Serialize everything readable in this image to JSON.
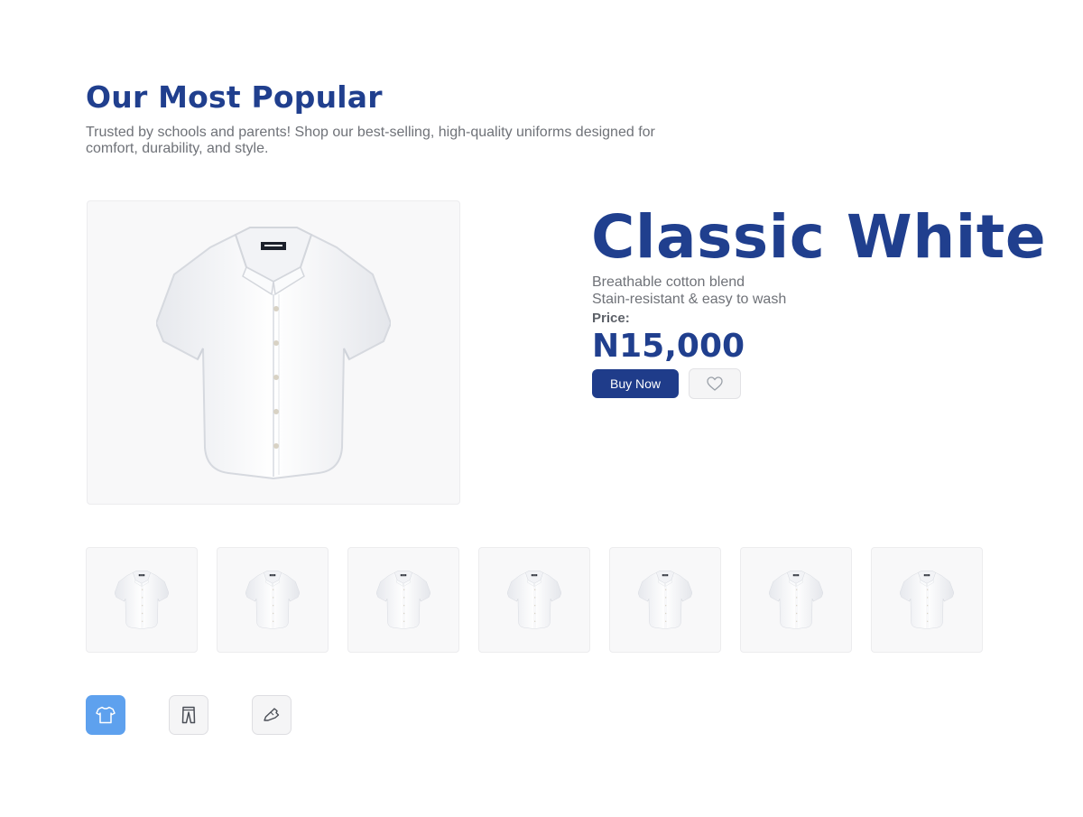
{
  "header": {
    "title": "Our Most Popular",
    "subtitle": "Trusted by schools and parents! Shop our best-selling, high-quality uniforms designed for comfort, durability, and style."
  },
  "product": {
    "name": "Classic White",
    "features": [
      "Breathable cotton blend",
      "Stain-resistant & easy to wash"
    ],
    "price_label": "Price:",
    "price": "N15,000",
    "buy_label": "Buy Now",
    "wishlist_icon": "heart-icon",
    "image": "white-short-sleeve-shirt"
  },
  "thumbnails": [
    {
      "image": "white-short-sleeve-shirt"
    },
    {
      "image": "white-short-sleeve-shirt"
    },
    {
      "image": "white-short-sleeve-shirt"
    },
    {
      "image": "white-short-sleeve-shirt"
    },
    {
      "image": "white-short-sleeve-shirt"
    },
    {
      "image": "white-short-sleeve-shirt"
    },
    {
      "image": "white-short-sleeve-shirt"
    }
  ],
  "categories": [
    {
      "icon": "shirt-icon",
      "active": true
    },
    {
      "icon": "trousers-icon",
      "active": false
    },
    {
      "icon": "shoe-icon",
      "active": false
    }
  ],
  "colors": {
    "brand": "#203f8e",
    "button": "#1f3c8a",
    "active_category": "#5ea1ee",
    "text_muted": "#6f7278"
  }
}
